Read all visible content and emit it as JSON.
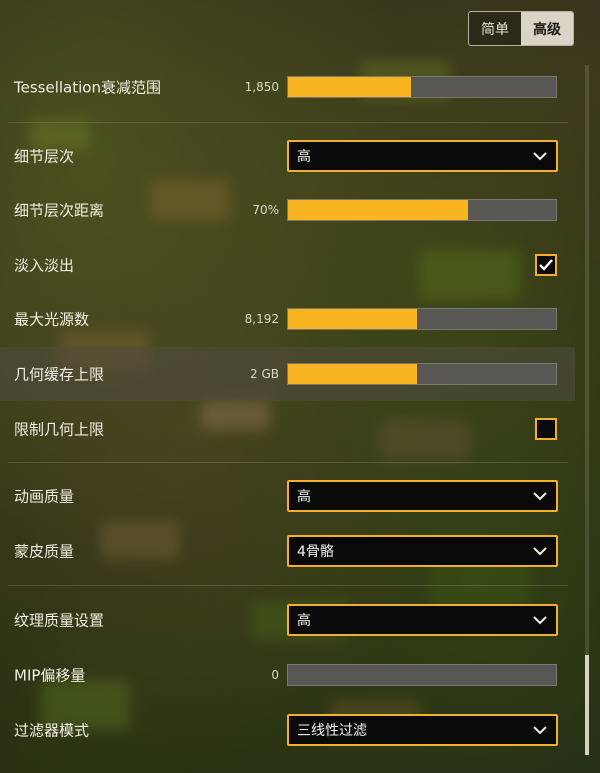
{
  "mode_switch": {
    "simple_label": "简单",
    "advanced_label": "高级",
    "active": "advanced"
  },
  "settings": {
    "tessellation": {
      "label": "Tessellation衰减范围",
      "value_text": "1,850",
      "fill_percent": 46
    },
    "lod": {
      "label": "细节层次",
      "selected": "高"
    },
    "lod_distance": {
      "label": "细节层次距离",
      "value_text": "70%",
      "fill_percent": 67
    },
    "fade": {
      "label": "淡入淡出",
      "checked": true
    },
    "max_lights": {
      "label": "最大光源数",
      "value_text": "8,192",
      "fill_percent": 48
    },
    "geometry_cache": {
      "label": "几何缓存上限",
      "value_text": "2 GB",
      "fill_percent": 48
    },
    "limit_geometry": {
      "label": "限制几何上限",
      "checked": false
    },
    "animation_quality": {
      "label": "动画质量",
      "selected": "高"
    },
    "skin_quality": {
      "label": "蒙皮质量",
      "selected": "4骨骼"
    },
    "texture_quality": {
      "label": "纹理质量设置",
      "selected": "高"
    },
    "mip_bias": {
      "label": "MIP偏移量",
      "value_text": "0",
      "fill_percent": 0
    },
    "filter_mode": {
      "label": "过滤器模式",
      "selected": "三线性过滤"
    }
  },
  "colors": {
    "accent": "#f8b521",
    "track": "#585754"
  },
  "icons": {
    "dropdown": "chevron-down-icon",
    "checkbox": "check-icon"
  }
}
